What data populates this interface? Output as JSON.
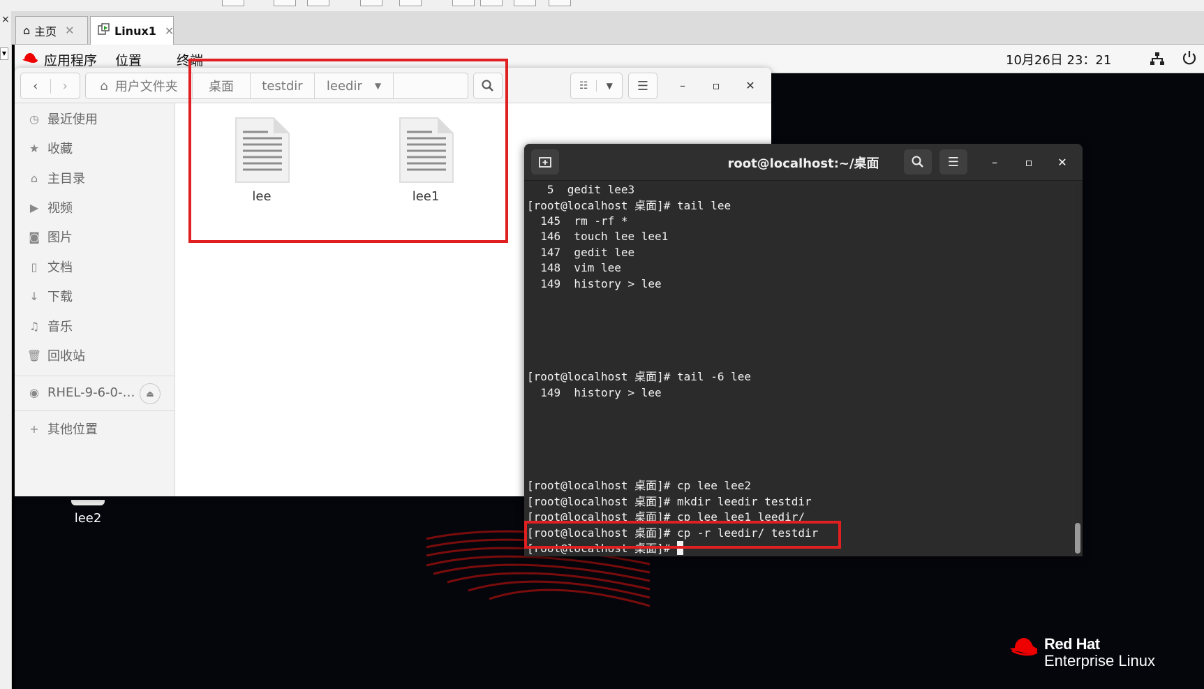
{
  "host": {
    "tabs": [
      {
        "label": "主页",
        "icon": "home-icon"
      },
      {
        "label": "Linux1",
        "icon": "vm-icon"
      }
    ]
  },
  "topbar": {
    "applications": "应用程序",
    "places": "位置",
    "terminal": "终端",
    "clock": "10月26日 23：21"
  },
  "file_manager": {
    "path": [
      "用户文件夹",
      "桌面",
      "testdir",
      "leedir"
    ],
    "sidebar": [
      {
        "label": "最近使用",
        "icon": "clock-icon"
      },
      {
        "label": "收藏",
        "icon": "star-icon"
      },
      {
        "label": "主目录",
        "icon": "home-icon"
      },
      {
        "label": "视频",
        "icon": "video-icon"
      },
      {
        "label": "图片",
        "icon": "camera-icon"
      },
      {
        "label": "文档",
        "icon": "document-icon"
      },
      {
        "label": "下载",
        "icon": "download-icon"
      },
      {
        "label": "音乐",
        "icon": "music-icon"
      },
      {
        "label": "回收站",
        "icon": "trash-icon"
      }
    ],
    "device": "RHEL-9-6-0-…",
    "other_locations": "其他位置",
    "files": [
      "lee",
      "lee1"
    ]
  },
  "desktop": {
    "icon_label": "lee2",
    "brand_line1": "Red Hat",
    "brand_line2": "Enterprise Linux"
  },
  "terminal": {
    "title": "root@localhost:~/桌面",
    "lines": [
      "   5  gedit lee3",
      "[root@localhost 桌面]# tail lee",
      "  145  rm -rf *",
      "  146  touch lee lee1",
      "  147  gedit lee",
      "  148  vim lee",
      "  149  history > lee",
      "[root@localhost 桌面]# tail -6 lee",
      "  149  history > lee",
      "[root@localhost 桌面]# cp lee lee2",
      "[root@localhost 桌面]# mkdir leedir testdir",
      "[root@localhost 桌面]# cp lee lee1 leedir/",
      "[root@localhost 桌面]# cp -r leedir/ testdir",
      "[root@localhost 桌面]# "
    ]
  },
  "colors": {
    "annotation": "#e02020",
    "terminal_bg": "#2b2b2b",
    "redhat_red": "#ee0000"
  }
}
